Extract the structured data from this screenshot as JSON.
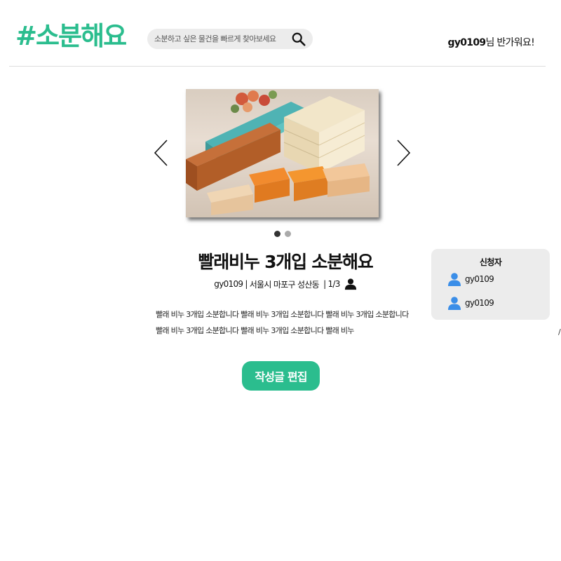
{
  "brand": {
    "logo_text": "#소분해요",
    "accent_color": "#2bbd8e"
  },
  "search": {
    "placeholder": "소분하고 싶은 물건을 빠르게 찾아보세요",
    "icon": "search-icon"
  },
  "header": {
    "username": "gy0109",
    "welcome_suffix": "님 반가워요!"
  },
  "post": {
    "image_alt": "빨래비누 사진",
    "image_count": 2,
    "active_image": 1,
    "title": "빨래비누 3개입 소분해요",
    "author": "gy0109",
    "location": "서울시 마포구 성산동",
    "participants": "1/3",
    "description": "빨래 비누 3개입 소분합니다 빨래 비누 3개입 소분합니다 빨래 비누 3개입 소분합니다 빨래 비누 3개입 소분합니다 빨래 비누 3개입 소분합니다  빨래 비누",
    "edit_button_label": "작성글 편집"
  },
  "applicants": {
    "title": "신청자",
    "items": [
      {
        "name": "gy0109"
      },
      {
        "name": "gy0109"
      }
    ]
  },
  "edge_mark": "/"
}
